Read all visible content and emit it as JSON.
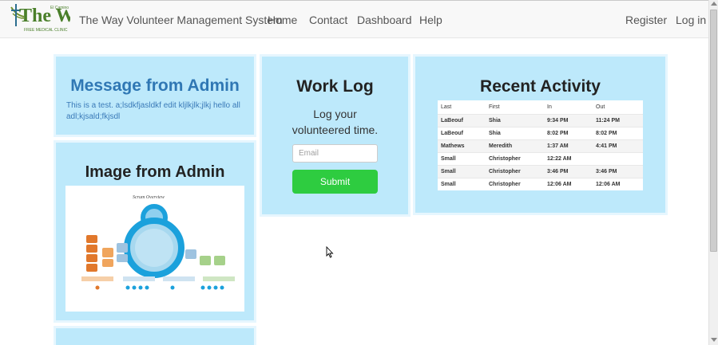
{
  "navbar": {
    "logo_text": "The Way",
    "logo_sub": "FREE MEDICAL CLINIC",
    "logo_tag": "El Camino",
    "brand": "The Way Volunteer Management System",
    "links": [
      "Home",
      "Contact",
      "Dashboard",
      "Help"
    ],
    "right_links": [
      "Register",
      "Log in"
    ]
  },
  "message_panel": {
    "title": "Message from Admin",
    "body": "This is a test. a;lsdkfjasldkf edit kljlkjlk;jlkj hello all adl;kjsald;fkjsdl"
  },
  "image_panel": {
    "title": "Image from Admin",
    "image_caption": "Scrum Overview"
  },
  "worklog_panel": {
    "title": "Work Log",
    "subtitle_line1": "Log your",
    "subtitle_line2": "volunteered time.",
    "email_placeholder": "Email",
    "submit_label": "Submit"
  },
  "activity_panel": {
    "title": "Recent Activity",
    "headers": [
      "Last",
      "First",
      "In",
      "Out"
    ],
    "rows": [
      [
        "LaBeouf",
        "Shia",
        "9:34 PM",
        "11:24 PM"
      ],
      [
        "LaBeouf",
        "Shia",
        "8:02 PM",
        "8:02 PM"
      ],
      [
        "Mathews",
        "Meredith",
        "1:37 AM",
        "4:41 PM"
      ],
      [
        "Small",
        "Christopher",
        "12:22 AM",
        ""
      ],
      [
        "Small",
        "Christopher",
        "3:46 PM",
        "3:46 PM"
      ],
      [
        "Small",
        "Christopher",
        "12:06 AM",
        "12:06 AM"
      ]
    ]
  },
  "colors": {
    "panel_bg": "#bde9fb",
    "accent_blue": "#2f77b4",
    "submit_green": "#2ecc40"
  }
}
